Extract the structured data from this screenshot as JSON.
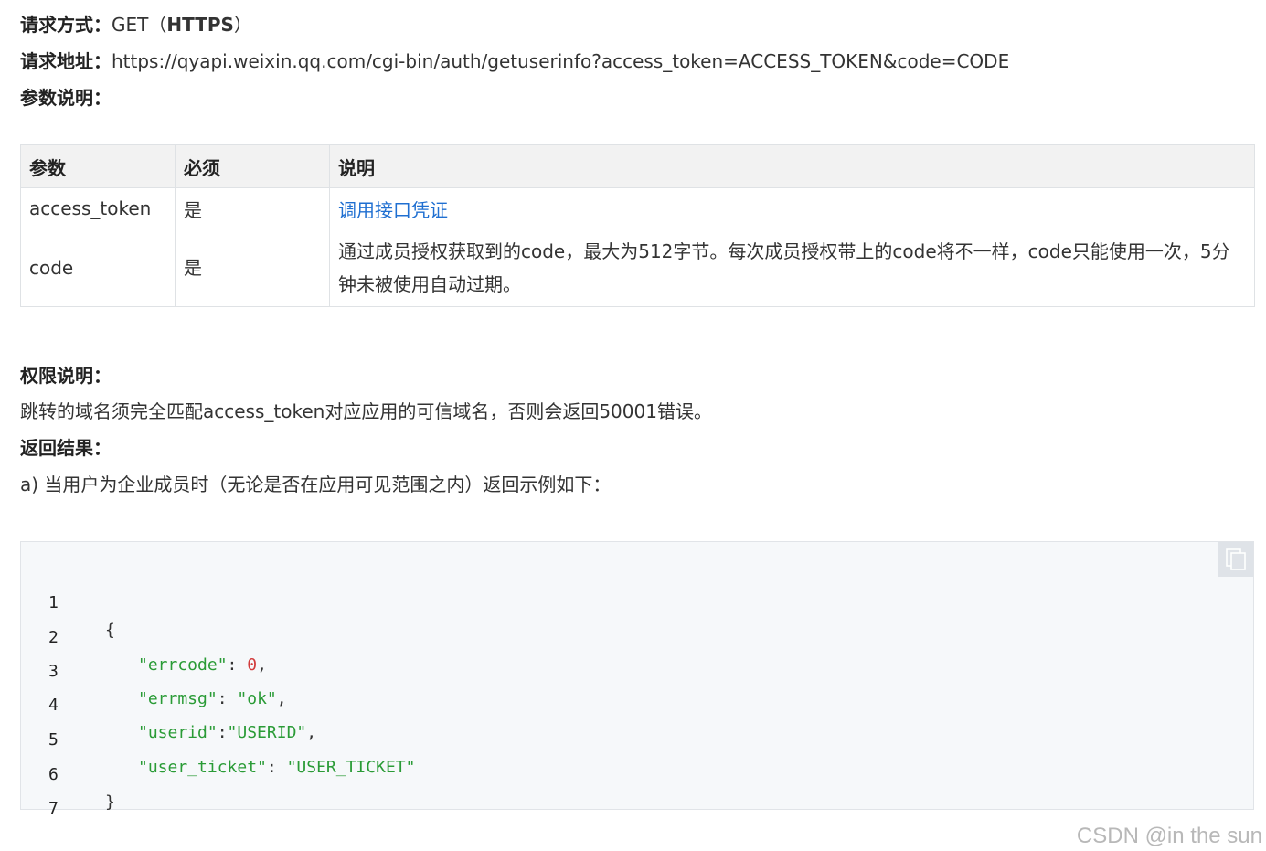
{
  "request": {
    "method_label": "请求方式：",
    "method_value": "GET（",
    "method_strong": "HTTPS",
    "method_close": "）",
    "address_label": "请求地址：",
    "address_value": "https://qyapi.weixin.qq.com/cgi-bin/auth/getuserinfo?access_token=ACCESS_TOKEN&code=CODE",
    "params_label": "参数说明："
  },
  "table": {
    "headers": [
      "参数",
      "必须",
      "说明"
    ],
    "rows": [
      {
        "param": "access_token",
        "required": "是",
        "desc": "调用接口凭证"
      },
      {
        "param": "code",
        "required": "是",
        "desc": "通过成员授权获取到的code，最大为512字节。每次成员授权带上的code将不一样，code只能使用一次，5分钟未被使用自动过期。"
      }
    ]
  },
  "permission": {
    "label": "权限说明：",
    "text": "跳转的域名须完全匹配access_token对应应用的可信域名，否则会返回50001错误。"
  },
  "result": {
    "label": "返回结果：",
    "case_a": "a) 当用户为企业成员时（无论是否在应用可见范围之内）返回示例如下："
  },
  "code": {
    "line_numbers": [
      "1",
      "2",
      "3",
      "4",
      "5",
      "6",
      "7"
    ],
    "open_brace": "{",
    "close_brace": "}",
    "errcode_key": "\"errcode\"",
    "errcode_val": "0",
    "errmsg_key": "\"errmsg\"",
    "errmsg_val": "\"ok\"",
    "userid_key": "\"userid\"",
    "userid_val": "\"USERID\"",
    "ticket_key": "\"user_ticket\"",
    "ticket_val": "\"USER_TICKET\""
  },
  "icons": {
    "copy": "copy-icon"
  },
  "watermark": "CSDN @in the sun"
}
